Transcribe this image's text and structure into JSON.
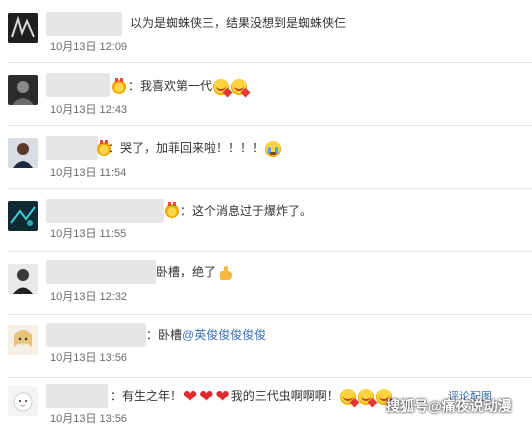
{
  "colors": {
    "mention": "#3b6fb6",
    "timestamp": "#6b6b6b",
    "separator": "#e8e8e8",
    "heart": "#e0282f"
  },
  "comments": [
    {
      "text": "以为是蜘蛛侠三，结果没想到是蜘蛛侠仨",
      "time": "10月13日 12:09",
      "avatar_icon": "user-avatar-icon"
    },
    {
      "prefix": "：我喜欢第一代",
      "time": "10月13日 12:43",
      "emojis": [
        "love-face-emoji",
        "love-face-emoji"
      ]
    },
    {
      "text": "：哭了，加菲回来啦！！！！",
      "time": "10月13日 11:54",
      "emojis": [
        "crying-face-emoji"
      ]
    },
    {
      "text": "：这个消息过于爆炸了。",
      "time": "10月13日 11:55"
    },
    {
      "text": "卧槽，绝了",
      "time": "10月13日 12:32",
      "emojis": [
        "thumbs-up-emoji"
      ]
    },
    {
      "text": "：卧槽",
      "mention": "@英俊俊俊俊俊",
      "time": "10月13日 13:56"
    },
    {
      "text_before": "：有生之年！",
      "text_after": "我的三代虫啊啊啊！",
      "hearts": [
        "❤",
        "❤",
        "❤"
      ],
      "time": "10月13日 13:56",
      "extra_link": "评论配图"
    }
  ],
  "watermark": "搜狐号@痛夜说动漫"
}
